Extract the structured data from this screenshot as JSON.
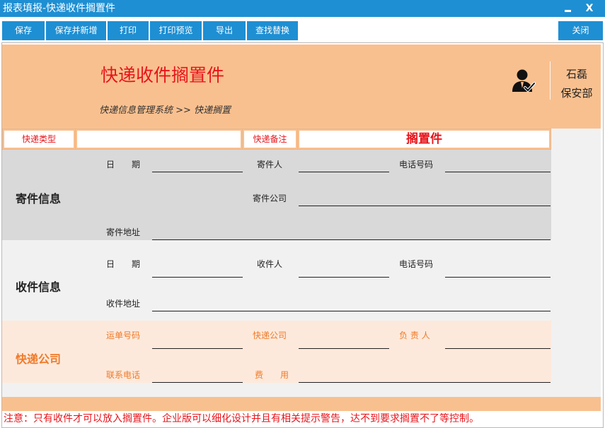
{
  "window": {
    "title": "报表填报-快递收件搁置件",
    "minimize_label": "",
    "close_label": "X"
  },
  "toolbar": {
    "save": "保存",
    "save_new": "保存并新增",
    "print": "打印",
    "print_preview": "打印预览",
    "export": "导出",
    "find_replace": "查找替换",
    "close": "关闭"
  },
  "header": {
    "title": "快递收件搁置件",
    "breadcrumb": "快递信息管理系统 >> 快递搁置",
    "user_name": "石磊",
    "user_dept": "保安部",
    "user_icon": "user-check-icon"
  },
  "type_row": {
    "type_label": "快递类型",
    "type_value": "",
    "remark_label": "快递备注",
    "remark_value": "搁置件"
  },
  "sender": {
    "section": "寄件信息",
    "date_label": "日　　期",
    "person_label": "寄件人",
    "phone_label": "电话号码",
    "company_label": "寄件公司",
    "address_label": "寄件地址"
  },
  "receiver": {
    "section": "收件信息",
    "date_label": "日　　期",
    "person_label": "收件人",
    "phone_label": "电话号码",
    "address_label": "收件地址"
  },
  "courier": {
    "section": "快递公司",
    "waybill_label": "运单号码",
    "company_label": "快递公司",
    "manager_label": "负 责 人",
    "contact_label": "联系电话",
    "fee_label": "费　　用"
  },
  "notice": "注意：只有收件才可以放入搁置件。企业版可以细化设计并且有相关提示警告，达不到要求搁置不了等控制。",
  "colors": {
    "titlebar": "#1e8fd3",
    "header_bg": "#f9c08f",
    "title_red": "#e8141b",
    "courier_orange": "#f07a28"
  }
}
